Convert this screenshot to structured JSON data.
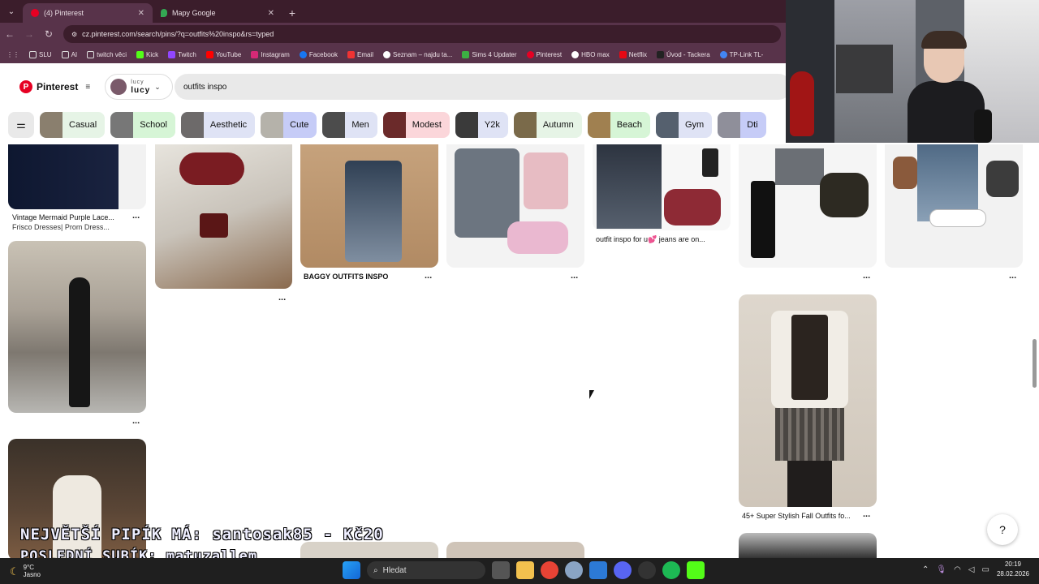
{
  "browser": {
    "tabs": [
      {
        "label": "(4) Pinterest",
        "active": true
      },
      {
        "label": "Mapy Google",
        "active": false
      }
    ],
    "url": "cz.pinterest.com/search/pins/?q=outfits%20inspo&rs=typed",
    "bookmarks": [
      "SLU",
      "AI",
      "twitch věci",
      "Kick",
      "Twitch",
      "YouTube",
      "Instagram",
      "Facebook",
      "Email",
      "Seznam – najdu ta...",
      "Sims 4 Updater",
      "Pinterest",
      "HBO max",
      "Netflix",
      "Úvod - Tackera",
      "TP-Link TL-"
    ]
  },
  "header": {
    "logo": "Pinterest",
    "account_small": "lucy",
    "account_name": "lucy",
    "search_value": "outfits inspo"
  },
  "chips": [
    {
      "label": "Casual",
      "color": "#e6f4e6"
    },
    {
      "label": "School",
      "color": "#d6f5d6"
    },
    {
      "label": "Aesthetic",
      "color": "#dfe3f5"
    },
    {
      "label": "Cute",
      "color": "#c6ccf7"
    },
    {
      "label": "Men",
      "color": "#dfe3f5"
    },
    {
      "label": "Modest",
      "color": "#fbd6da"
    },
    {
      "label": "Y2k",
      "color": "#dfe3f5"
    },
    {
      "label": "Autumn",
      "color": "#e6f4e6"
    },
    {
      "label": "Beach",
      "color": "#d6f5d6"
    },
    {
      "label": "Gym",
      "color": "#dfe3f5"
    },
    {
      "label": "Dti",
      "color": "#c6ccf7"
    }
  ],
  "pins": {
    "mermaid_title": "Vintage Mermaid Purple Lace...",
    "mermaid_sub": "Frisco Dresses| Prom Dress...",
    "baggy_title": "BAGGY OUTFITS INSPO",
    "jeans_title": "outfit inspo for u💕 jeans are on...",
    "fall_title": "45+ Super Stylish Fall Outfits fo...",
    "dots": "..."
  },
  "overlay": {
    "line1": "NEJVĚTŠÍ PIPÍK MÁ: santosak85 - Kč20",
    "line2": "POSLEDNÍ SUBÍK: matuzallem"
  },
  "taskbar": {
    "temp": "9°C",
    "weather": "Jasno",
    "search_label": "Hledat",
    "time": "20:19",
    "date": "28.02.2026"
  },
  "help_label": "?"
}
